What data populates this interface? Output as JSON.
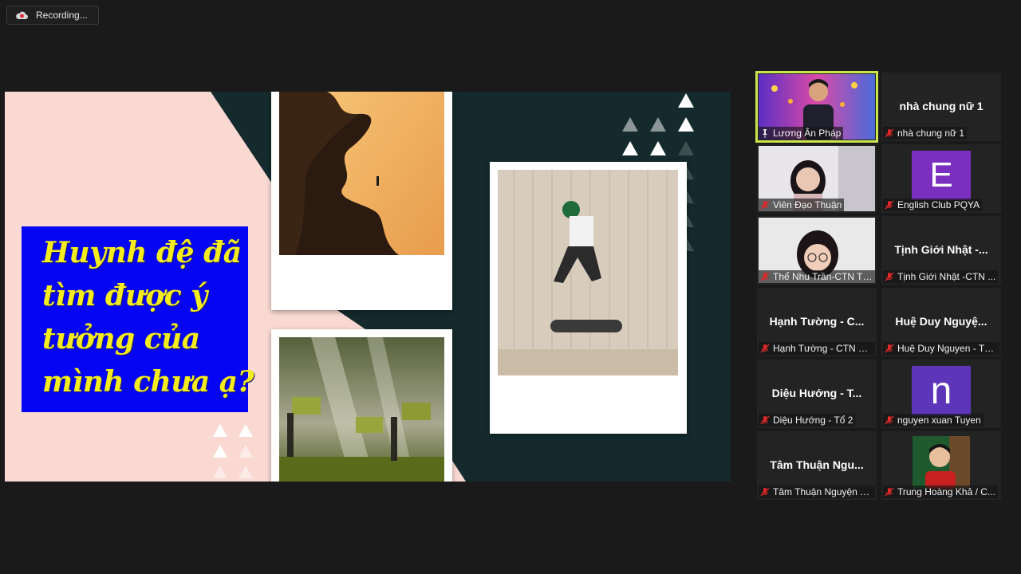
{
  "recording": {
    "label": "Recording..."
  },
  "slide": {
    "title_lines": [
      "Huynh đệ đã",
      "tìm được ý",
      "tưởng của",
      "mình chưa ạ?"
    ],
    "colors": {
      "title_bg": "#0505f3",
      "title_text": "#f4ec1e",
      "pink": "#f9d9d2",
      "teal": "#142a2c"
    }
  },
  "participants": [
    {
      "name": "Lương Ân Pháp",
      "center": "",
      "mic_muted": false,
      "pinned": true,
      "active": true,
      "avatar": "camera-student-lantern"
    },
    {
      "name": "nhà chung nữ 1",
      "center": "nhà chung nữ 1",
      "mic_muted": true
    },
    {
      "name": "Viên Đạo Thuận",
      "center": "",
      "mic_muted": true,
      "avatar": "camera-girl"
    },
    {
      "name": "English Club PQYA",
      "center": "",
      "mic_muted": true,
      "letter": "E",
      "letter_color": "#7b2fbe"
    },
    {
      "name": "Thể Nhu Trần-CTN TP...",
      "center": "",
      "mic_muted": true,
      "avatar": "camera-girl-glasses"
    },
    {
      "name": "Tịnh Giới Nhật -CTN ...",
      "center": "Tịnh Giới Nhật -...",
      "mic_muted": true
    },
    {
      "name": "Hạnh Tường - CTN Bì...",
      "center": "Hạnh Tường - C...",
      "mic_muted": true
    },
    {
      "name": "Huệ Duy Nguyen - Tổ...",
      "center": "Huệ Duy Nguyệ...",
      "mic_muted": true
    },
    {
      "name": "Diệu Hướng - Tổ 2",
      "center": "Diệu Hướng - T...",
      "mic_muted": true
    },
    {
      "name": "nguyen xuan Tuyen",
      "center": "",
      "mic_muted": true,
      "letter": "n",
      "letter_color": "#5c35b8"
    },
    {
      "name": "Tâm Thuận Nguyện - ...",
      "center": "Tâm Thuận Ngu...",
      "mic_muted": true
    },
    {
      "name": "Trung Hoàng Khả / C...",
      "center": "",
      "mic_muted": true,
      "avatar": "camera-boy"
    }
  ]
}
